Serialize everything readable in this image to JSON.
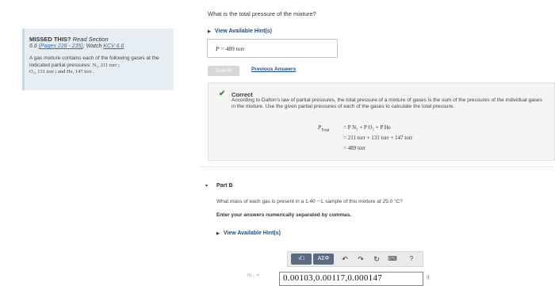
{
  "missed": {
    "title": "MISSED THIS?",
    "read": "Read Section",
    "section": "6.6",
    "pages": "(Pages 228 - 235)",
    "watch": "; Watch",
    "kcv": "KCV 6.6",
    "body_intro": "A gas mixture contains each of the following gases at the indicated partial pressures:",
    "body_gases_1": "N₂, 211 torr ;",
    "body_gases_2": "O₂, 131 torr ; and He, 147 torr ."
  },
  "partA": {
    "question": "What is the total pressure of the mixture?",
    "hints_label": "View Available Hint(s)",
    "answer_var": "P",
    "answer_value": "= 489 torr",
    "submit_label": "Submit",
    "previous_answers_label": "Previous Answers",
    "correct_title": "Correct",
    "correct_text": "According to Dalton's law of partial pressures, the total pressure of a mixture of gases is the sum of the pressures of the individual gases in the mixture. Use the given partial pressures of each of the gases to calculate the total pressure.",
    "eq_lhs": "P",
    "eq_lhs_sub": "Total",
    "eq_line1": "= P N₂ + P O₂ + P He",
    "eq_line2": "= 211 torr + 131 torr + 147 torr",
    "eq_line3": "= 489 torr"
  },
  "partB": {
    "label": "Part B",
    "question": "What mass of each gas is present in a 1.40 − L sample of this mixture at 25.0 °C?",
    "enter": "Enter your answers numerically separated by commas.",
    "hints_label": "View Available Hint(s)",
    "toolbar": {
      "templates": "√□",
      "greek": "ΑΣΦ",
      "help": "?"
    },
    "input_value": "0.00103,0.00117,0.000147",
    "input_prefix": "m... =",
    "unit": "g"
  }
}
